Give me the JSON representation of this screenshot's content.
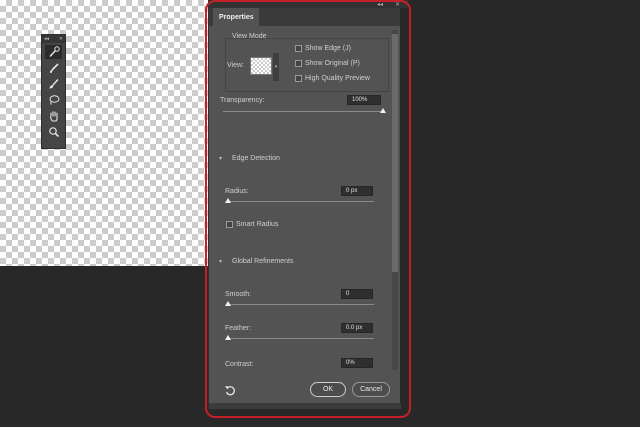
{
  "colors": {
    "highlight": "#c4202a",
    "panel_bg": "#535353",
    "app_bg": "#282828"
  },
  "toolbox": {
    "header_left": "◂◂",
    "header_right": "✕",
    "tools": [
      {
        "name": "quick-selection-icon",
        "active": true
      },
      {
        "name": "refine-edge-brush-icon",
        "active": false
      },
      {
        "name": "brush-icon",
        "active": false
      },
      {
        "name": "lasso-icon",
        "active": false
      },
      {
        "name": "hand-icon",
        "active": false
      },
      {
        "name": "zoom-icon",
        "active": false
      }
    ]
  },
  "panel_strip": {
    "collapse": "◂◂",
    "close": "✕"
  },
  "properties": {
    "tab_label": "Properties",
    "view_mode": {
      "heading": "View Mode",
      "view_label": "View:",
      "show_edge": "Show Edge (J)",
      "show_original": "Show Original (P)",
      "high_quality_preview": "High Quality Preview"
    },
    "transparency": {
      "label": "Transparency:",
      "value": "100%",
      "level": 1.0
    },
    "edge_detection": {
      "heading": "Edge Detection",
      "radius_label": "Radius:",
      "radius_value": "0 px",
      "radius_level": 0,
      "smart_radius": "Smart Radius"
    },
    "global_refinements": {
      "heading": "Global Refinements",
      "smooth_label": "Smooth:",
      "smooth_value": "0",
      "smooth_level": 0,
      "feather_label": "Feather:",
      "feather_value": "0.0 px",
      "feather_level": 0,
      "contrast_label": "Contrast:",
      "contrast_value": "0%"
    },
    "buttons": {
      "ok": "OK",
      "cancel": "Cancel"
    }
  }
}
